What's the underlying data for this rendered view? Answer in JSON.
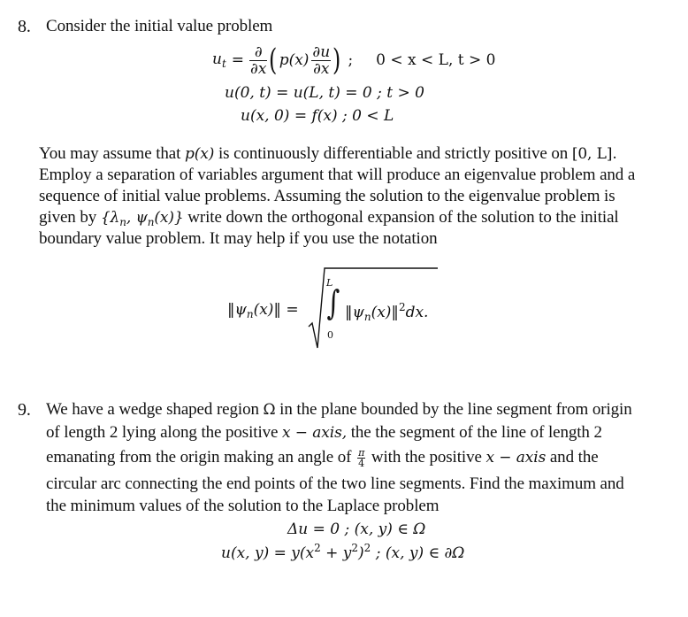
{
  "problem8": {
    "number": "8.",
    "intro": "Consider the initial value problem",
    "eq1": {
      "lhs_var": "u",
      "lhs_sub": "t",
      "eq": "=",
      "d_top": "∂",
      "d_bot": "∂x",
      "p_of_x": "p(x)",
      "du_top": "∂u",
      "du_bot": "∂x",
      "semicolon": ";",
      "condition": "0 < x < L, t > 0"
    },
    "eq2": "u(0, t) = u(L, t) = 0 ;  t > 0",
    "eq3": "u(x, 0) = f(x) ;    0 < L",
    "paragraph": [
      "You may assume that p(x) is continuously differentiable and strictly positive on [0, L].",
      "Employ a separation of variables argument that will produce an eigenvalue problem and a",
      "sequence of initial value problems.   Assuming the solution to the eigenvalue problem is",
      "given by {λn, ψn(x)} write down the orthogonal expansion of the solution to the initial",
      "boundary value problem.  It may help if you use the notation"
    ],
    "para_parts": {
      "l1_a": "You may assume that ",
      "l1_math": "p(x)",
      "l1_b": " is continuously differentiable and strictly positive on ",
      "l1_math2": "[0, L].",
      "l2": "Employ a separation of variables argument that will produce an eigenvalue problem and a",
      "l3": "sequence of initial value problems.   Assuming the solution to the eigenvalue problem is",
      "l4_a": "given by ",
      "l4_math": "{λ",
      "l4_sub1": "n",
      "l4_math2": ", ψ",
      "l4_sub2": "n",
      "l4_math3": "(x)}",
      "l4_b": " write down the orthogonal expansion of the solution to the initial",
      "l5": "boundary value problem.  It may help if you use the notation"
    },
    "norm_eq": {
      "lhs": "‖ψ",
      "lhs_sub": "n",
      "lhs_end": "(x)‖ =",
      "int_upper": "L",
      "int_lower": "0",
      "integral": "∫",
      "integrand": "‖ψ",
      "integrand_sub": "n",
      "integrand_end": "(x)‖",
      "integrand_sup": "2",
      "dx": "dx."
    }
  },
  "problem9": {
    "number": "9.",
    "lines": {
      "l1_a": "We have a wedge shaped region ",
      "l1_omega": "Ω",
      "l1_b": " in the plane bounded by the line segment from origin",
      "l2_a": "of length 2 lying along the positive ",
      "l2_math": "x − axis,",
      "l2_b": " the the segment of the line of length 2",
      "l3_a": "emanating from the origin making an angle of ",
      "l3_frac_top": "π",
      "l3_frac_bot": "4",
      "l3_b": " with the positive ",
      "l3_math": "x − axis",
      "l3_c": " and the",
      "l4": "circular arc connecting the end points of the two line segments. Find the maximum and",
      "l5": "the minimum values of the solution to the Laplace problem"
    },
    "eq1": "Δu = 0 ;   (x, y) ∈ Ω",
    "eq2": {
      "a": "u(x, y) = y(x",
      "sup1": "2",
      "b": " + y",
      "sup2": "2",
      "c": ")",
      "sup3": "2",
      "d": " ;    (x, y) ∈ ∂Ω"
    }
  }
}
